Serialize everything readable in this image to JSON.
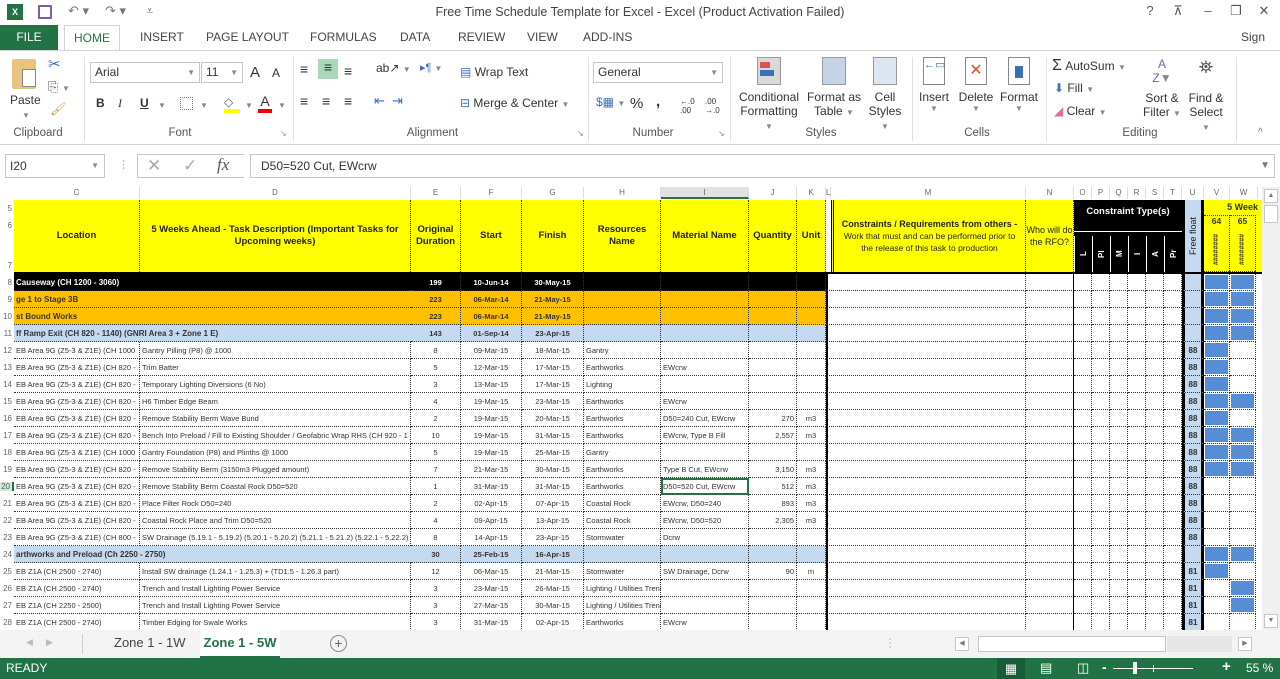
{
  "window": {
    "title": "Free Time Schedule Template for Excel - Excel (Product Activation Failed)",
    "help": "?",
    "sign_in": "Sign in"
  },
  "ribbon_tabs": [
    "FILE",
    "HOME",
    "INSERT",
    "PAGE LAYOUT",
    "FORMULAS",
    "DATA",
    "REVIEW",
    "VIEW",
    "ADD-INS"
  ],
  "active_tab": "HOME",
  "ribbon": {
    "clipboard": {
      "paste": "Paste",
      "label": "Clipboard"
    },
    "font": {
      "name": "Arial",
      "size": "11",
      "bold": "B",
      "italic": "I",
      "underline": "U",
      "label": "Font",
      "grow": "A",
      "shrink": "A"
    },
    "alignment": {
      "wrap_text": "Wrap Text",
      "merge_center": "Merge & Center",
      "label": "Alignment"
    },
    "number": {
      "format": "General",
      "percent": "%",
      "comma": ",",
      "inc_dec": "←.0 .00",
      "dec_dec": ".00 →.0",
      "label": "Number"
    },
    "styles": {
      "conditional": "Conditional",
      "conditional2": "Formatting",
      "format_as": "Format as",
      "format_as2": "Table",
      "cell": "Cell",
      "cell2": "Styles",
      "label": "Styles"
    },
    "cells": {
      "insert": "Insert",
      "delete": "Delete",
      "format": "Format",
      "label": "Cells"
    },
    "editing": {
      "autosum": "AutoSum",
      "fill": "Fill",
      "clear": "Clear",
      "sort": "Sort &",
      "sort2": "Filter",
      "find": "Find &",
      "find2": "Select",
      "label": "Editing"
    }
  },
  "formula_bar": {
    "name_box": "I20",
    "fx": "fx",
    "content": "D50=520 Cut, EWcrw"
  },
  "columns": [
    "C",
    "D",
    "E",
    "F",
    "G",
    "H",
    "I",
    "J",
    "K",
    "L",
    "M",
    "N",
    "O",
    "P",
    "Q",
    "R",
    "S",
    "T",
    "U",
    "V",
    "W"
  ],
  "row_numbers": [
    "5",
    "6",
    "7",
    "8",
    "9",
    "10",
    "11",
    "12",
    "13",
    "14",
    "15",
    "16",
    "17",
    "18",
    "19",
    "20",
    "21",
    "22",
    "23",
    "24",
    "25",
    "26",
    "27",
    "28"
  ],
  "headers": {
    "location": "Location",
    "task": "5 Weeks Ahead - Task Description (Important Tasks for Upcoming weeks)",
    "duration": "Original Duration",
    "start": "Start",
    "finish": "Finish",
    "resources": "Resources Name",
    "material": "Material Name",
    "quantity": "Quantity",
    "unit": "Unit",
    "constraints_title": "Constraints / Requirements from others -",
    "constraints_sub": "Work that must and can be performed prior to the release of this task to production",
    "who": "Who will do the RFO?",
    "constraint_types": "Constraint Type(s)",
    "constraint_cols": [
      "L",
      "Pl",
      "M",
      "I",
      "A",
      "Pr"
    ],
    "free_float": "Free float",
    "weeks": "5 Week",
    "week_nums": [
      "64",
      "65"
    ],
    "week_dates": [
      "########",
      "########"
    ]
  },
  "rows": [
    {
      "type": "black",
      "location": "Causeway (CH 1200 - 3060)",
      "task": "",
      "duration": "199",
      "start": "10-Jun-14",
      "finish": "30-May-15",
      "resource": "",
      "material": "",
      "qty": "",
      "unit": "",
      "float": "",
      "w64": true,
      "w65": true
    },
    {
      "type": "orange",
      "location": "ge 1 to Stage 3B",
      "task": "",
      "duration": "223",
      "start": "06-Mar-14",
      "finish": "21-May-15",
      "resource": "",
      "material": "",
      "qty": "",
      "unit": "",
      "float": "",
      "w64": true,
      "w65": true
    },
    {
      "type": "orange",
      "location": "st Bound Works",
      "task": "",
      "duration": "223",
      "start": "06-Mar-14",
      "finish": "21-May-15",
      "resource": "",
      "material": "",
      "qty": "",
      "unit": "",
      "float": "",
      "w64": true,
      "w65": true
    },
    {
      "type": "blue",
      "location": "ff Ramp Exit (CH 820 - 1140) (GNRI Area 3 + Zone 1 E)",
      "task": "",
      "duration": "143",
      "start": "01-Sep-14",
      "finish": "23-Apr-15",
      "resource": "",
      "material": "",
      "qty": "",
      "unit": "",
      "float": "",
      "w64": true,
      "w65": true
    },
    {
      "type": "normal",
      "location": "EB Area 9G (Z5-3 & Z1E) (CH 1000",
      "task": "Gantry Pilling (P8) @ 1000",
      "duration": "8",
      "start": "09-Mar-15",
      "finish": "18-Mar-15",
      "resource": "Gantry",
      "material": "",
      "qty": "",
      "unit": "",
      "float": "88",
      "w64": true,
      "w65": false
    },
    {
      "type": "normal",
      "location": "EB Area 9G (Z5-3 & Z1E) (CH 820 -",
      "task": "Trim Batter",
      "duration": "5",
      "start": "12-Mar-15",
      "finish": "17-Mar-15",
      "resource": "Earthworks",
      "material": "EWcrw",
      "qty": "",
      "unit": "",
      "float": "88",
      "w64": true,
      "w65": false
    },
    {
      "type": "normal",
      "location": "EB Area 9G (Z5-3 & Z1E) (CH 820 -",
      "task": "Temporary Lighting Diversions (6 No)",
      "duration": "3",
      "start": "13-Mar-15",
      "finish": "17-Mar-15",
      "resource": "Lighting",
      "material": "",
      "qty": "",
      "unit": "",
      "float": "88",
      "w64": true,
      "w65": false
    },
    {
      "type": "normal",
      "location": "EB Area 9G (Z5-3 & Z1E) (CH 820 -",
      "task": "H6 Timber Edge Beam",
      "duration": "4",
      "start": "19-Mar-15",
      "finish": "23-Mar-15",
      "resource": "Earthworks",
      "material": "EWcrw",
      "qty": "",
      "unit": "",
      "float": "88",
      "w64": true,
      "w65": true
    },
    {
      "type": "normal",
      "location": "EB Area 9G (Z5-3 & Z1E) (CH 820 -",
      "task": "Remove Stability Berm Wave Bund",
      "duration": "2",
      "start": "19-Mar-15",
      "finish": "20-Mar-15",
      "resource": "Earthworks",
      "material": "D50=240 Cut, EWcrw",
      "qty": "270",
      "unit": "m3",
      "float": "88",
      "w64": true,
      "w65": false
    },
    {
      "type": "normal",
      "location": "EB Area 9G (Z5-3 & Z1E) (CH 820 -",
      "task": "Bench Into Preload / Fill to Existing Shoulder / Geofabric Wrap RHS (CH 920 - 1",
      "duration": "10",
      "start": "19-Mar-15",
      "finish": "31-Mar-15",
      "resource": "Earthworks",
      "material": "EWcrw, Type B Fill",
      "qty": "2,557",
      "unit": "m3",
      "float": "88",
      "w64": true,
      "w65": true
    },
    {
      "type": "normal",
      "location": "EB Area 9G (Z5-3 & Z1E) (CH 1000",
      "task": "Gantry Foundation (P8) and Plinths @ 1000",
      "duration": "5",
      "start": "19-Mar-15",
      "finish": "25-Mar-15",
      "resource": "Gantry",
      "material": "",
      "qty": "",
      "unit": "",
      "float": "88",
      "w64": true,
      "w65": true
    },
    {
      "type": "normal",
      "location": "EB Area 9G (Z5-3 & Z1E) (CH 820 -",
      "task": "Remove Stability Berm (3150m3 Plugged amount)",
      "duration": "7",
      "start": "21-Mar-15",
      "finish": "30-Mar-15",
      "resource": "Earthworks",
      "material": "Type B Cut, EWcrw",
      "qty": "3,150",
      "unit": "m3",
      "float": "88",
      "w64": true,
      "w65": true
    },
    {
      "type": "normal",
      "location": "EB Area 9G (Z5-3 & Z1E) (CH 820 -",
      "task": "Remove Stability Berm Coastal Rock D50=520",
      "duration": "1",
      "start": "31-Mar-15",
      "finish": "31-Mar-15",
      "resource": "Earthworks",
      "material": "D50=520 Cut, EWcrw",
      "qty": "512",
      "unit": "m3",
      "float": "88",
      "w64": false,
      "w65": false,
      "selected": true
    },
    {
      "type": "normal",
      "location": "EB Area 9G (Z5-3 & Z1E) (CH 820 -",
      "task": "Place Filter Rock D50=240",
      "duration": "2",
      "start": "02-Apr-15",
      "finish": "07-Apr-15",
      "resource": "Coastal Rock",
      "material": "EWcrw, D50=240",
      "qty": "893",
      "unit": "m3",
      "float": "88",
      "w64": false,
      "w65": false
    },
    {
      "type": "normal",
      "location": "EB Area 9G (Z5-3 & Z1E) (CH 820 -",
      "task": "Coastal Rock Place and Trim D50=520",
      "duration": "4",
      "start": "09-Apr-15",
      "finish": "13-Apr-15",
      "resource": "Coastal Rock",
      "material": "EWcrw, D50=520",
      "qty": "2,305",
      "unit": "m3",
      "float": "88",
      "w64": false,
      "w65": false
    },
    {
      "type": "normal",
      "location": "EB Area 9G (Z5-3 & Z1E) (CH 800 -",
      "task": "SW Drainage (5.19.1 - 5.19.2) (5.20.1 - 5.20.2) (5.21.1 - 5.21.2) (5.22.1 - 5.22.2) (",
      "duration": "8",
      "start": "14-Apr-15",
      "finish": "23-Apr-15",
      "resource": "Stormwater",
      "material": "Dcrw",
      "qty": "",
      "unit": "",
      "float": "88",
      "w64": false,
      "w65": false
    },
    {
      "type": "blue",
      "location": "arthworks and Preload (Ch 2250 - 2750)",
      "task": "",
      "duration": "30",
      "start": "25-Feb-15",
      "finish": "16-Apr-15",
      "resource": "",
      "material": "",
      "qty": "",
      "unit": "",
      "float": "",
      "w64": true,
      "w65": true
    },
    {
      "type": "normal",
      "location": "EB Z1A (CH 2500 - 2740)",
      "task": "Install SW drainage (1.24.1 - 1.25.3) + (TD1.5 - 1.26.3 part)",
      "duration": "12",
      "start": "06-Mar-15",
      "finish": "21-Mar-15",
      "resource": "Stormwater",
      "material": "SW Drainage, Dcrw",
      "qty": "90",
      "unit": "m",
      "float": "81",
      "w64": true,
      "w65": false
    },
    {
      "type": "normal",
      "location": "EB Z1A (CH 2500 - 2740)",
      "task": "Trench and Install Lighting Power Service",
      "duration": "3",
      "start": "23-Mar-15",
      "finish": "26-Mar-15",
      "resource": "Lighting / Utilities Trench",
      "material": "",
      "qty": "",
      "unit": "",
      "float": "81",
      "w64": false,
      "w65": true
    },
    {
      "type": "normal",
      "location": "EB Z1A (CH 2250 - 2500)",
      "task": "Trench and Install Lighting Power Service",
      "duration": "3",
      "start": "27-Mar-15",
      "finish": "30-Mar-15",
      "resource": "Lighting / Utilities Trench",
      "material": "",
      "qty": "",
      "unit": "",
      "float": "81",
      "w64": false,
      "w65": true
    },
    {
      "type": "normal",
      "location": "EB Z1A (CH 2500 - 2740)",
      "task": "Timber Edging for Swale Works",
      "duration": "3",
      "start": "31-Mar-15",
      "finish": "02-Apr-15",
      "resource": "Earthworks",
      "material": "EWcrw",
      "qty": "",
      "unit": "",
      "float": "81",
      "w64": false,
      "w65": false
    }
  ],
  "sheets": [
    {
      "name": "Zone 1 - 1W",
      "active": false
    },
    {
      "name": "Zone 1 - 5W",
      "active": true
    }
  ],
  "status": {
    "ready": "READY",
    "zoom": "55 %"
  },
  "colors": {
    "excel_green": "#217346",
    "header_yellow": "#ffff00",
    "group_orange": "#ffc000",
    "group_blue": "#c5d9f1",
    "gantt_bar": "#558ed5"
  }
}
